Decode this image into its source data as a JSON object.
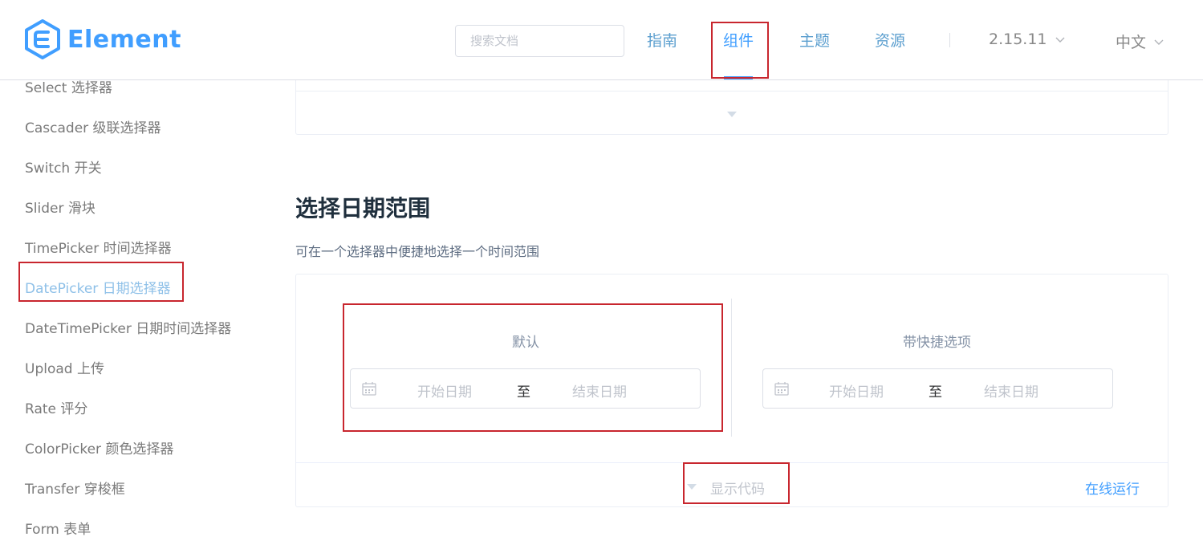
{
  "header": {
    "logo_text": "Element",
    "search_placeholder": "搜索文档",
    "nav": [
      "指南",
      "组件",
      "主题",
      "资源"
    ],
    "version": "2.15.11",
    "language": "中文"
  },
  "sidebar": {
    "items": [
      "Select 选择器",
      "Cascader 级联选择器",
      "Switch 开关",
      "Slider 滑块",
      "TimePicker 时间选择器",
      "DatePicker 日期选择器",
      "DateTimePicker 日期时间选择器",
      "Upload 上传",
      "Rate 评分",
      "ColorPicker 颜色选择器",
      "Transfer 穿梭框",
      "Form 表单"
    ],
    "active_index": 5
  },
  "main": {
    "section_title": "选择日期范围",
    "section_desc": "可在一个选择器中便捷地选择一个时间范围",
    "blocks": [
      {
        "label": "默认",
        "start_placeholder": "开始日期",
        "separator": "至",
        "end_placeholder": "结束日期"
      },
      {
        "label": "带快捷选项",
        "start_placeholder": "开始日期",
        "separator": "至",
        "end_placeholder": "结束日期"
      }
    ],
    "show_code": "显示代码",
    "run_online": "在线运行"
  },
  "colors": {
    "brand": "#409eff",
    "highlight": "#c8262e"
  }
}
